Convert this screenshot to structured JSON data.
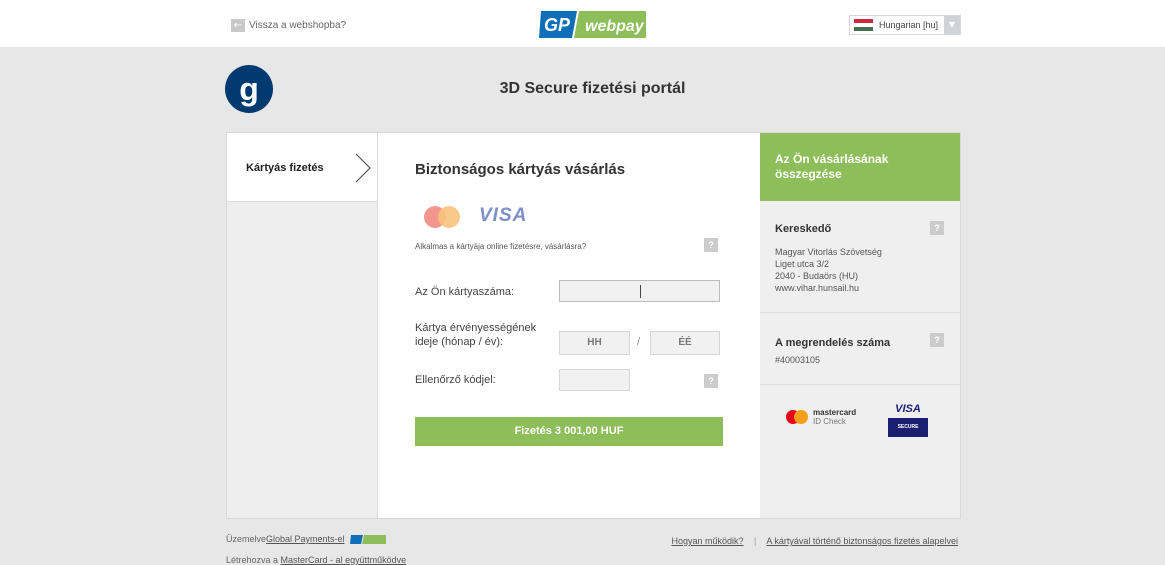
{
  "header": {
    "back_label": "Vissza a webshopba?",
    "back_icon": "arrow-left-icon",
    "logo_gp": "GP",
    "logo_webpay": "webpay",
    "language": "Hungarian [hu]",
    "language_arrow": "▼"
  },
  "portal": {
    "brand_mark": "g",
    "title": "3D Secure fizetési portál"
  },
  "steps": {
    "current": "Kártyás fizetés"
  },
  "form": {
    "title": "Biztonságos kártyás vásárlás",
    "visa_label": "VISA",
    "eligible_question": "Alkalmas a kártyája online fizetésre, vásárlásra?",
    "help_mark": "?",
    "card_number_label": "Az Ön kártyaszáma:",
    "card_number_value": "",
    "expiry_label": "Kártya érvényességének ideje (hónap / év):",
    "month_placeholder": "HH",
    "year_placeholder": "ÉÉ",
    "expiry_separator": "/",
    "cvc_label": "Ellenőrző kódjel:",
    "cvc_value": "",
    "pay_button": "Fizetés 3 001,00 HUF"
  },
  "summary": {
    "title": "Az Ön vásárlásának összegzése",
    "merchant_title": "Kereskedő",
    "merchant_lines": [
      "Magyar Vitorlás Szövetség",
      "Liget utca 3/2",
      "2040 - Budaörs (HU)",
      "www.vihar.hunsail.hu"
    ],
    "order_title": "A megrendelés száma",
    "order_number": "#40003105",
    "idcheck_brand": "mastercard",
    "idcheck_label": "ID Check",
    "visa_secure_top": "VISA",
    "visa_secure_bottom": "SECURE"
  },
  "footer": {
    "operated_prefix": "Üzemelve ",
    "operated_link": "Global Payments-el",
    "created_prefix": "Létrehozva a ",
    "created_link": "MasterCard - al együttműködve",
    "how_link": "Hogyan működik?",
    "separator": "|",
    "principles_link": "A kártyával történő biztonságos fizetés alapelvei"
  },
  "colors": {
    "accent_green": "#8dbe59",
    "gp_blue": "#0e6eb8",
    "visa_navy": "#1a1f71",
    "mc_red": "#eb001b",
    "mc_orange": "#f79e1b"
  }
}
